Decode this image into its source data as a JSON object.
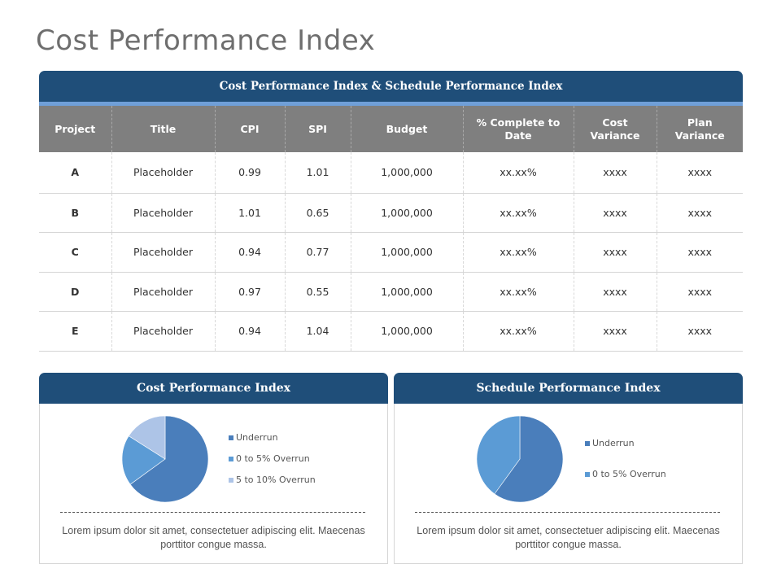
{
  "page": {
    "title": "Cost Performance Index"
  },
  "table": {
    "banner": "Cost Performance Index & Schedule Performance Index",
    "headers": [
      "Project",
      "Title",
      "CPI",
      "SPI",
      "Budget",
      "% Complete to Date",
      "Cost Variance",
      "Plan Variance"
    ],
    "rows": [
      [
        "A",
        "Placeholder",
        "0.99",
        "1.01",
        "1,000,000",
        "xx.xx%",
        "xxxx",
        "xxxx"
      ],
      [
        "B",
        "Placeholder",
        "1.01",
        "0.65",
        "1,000,000",
        "xx.xx%",
        "xxxx",
        "xxxx"
      ],
      [
        "C",
        "Placeholder",
        "0.94",
        "0.77",
        "1,000,000",
        "xx.xx%",
        "xxxx",
        "xxxx"
      ],
      [
        "D",
        "Placeholder",
        "0.97",
        "0.55",
        "1,000,000",
        "xx.xx%",
        "xxxx",
        "xxxx"
      ],
      [
        "E",
        "Placeholder",
        "0.94",
        "1.04",
        "1,000,000",
        "xx.xx%",
        "xxxx",
        "xxxx"
      ]
    ]
  },
  "colors": {
    "header_blue": "#1f4e79",
    "accent_blue": "#6f9fd8",
    "table_header_gray": "#7f7f7f",
    "underrun": "#4a7ebb",
    "overrun_0_5": "#5b9bd5",
    "overrun_5_10": "#adc4e7"
  },
  "chart_data": [
    {
      "type": "pie",
      "title": "Cost Performance Index",
      "categories": [
        "Underrun",
        "0 to 5% Overrun",
        "5 to 10% Overrun"
      ],
      "values": [
        65,
        19,
        16
      ],
      "colors": [
        "#4a7ebb",
        "#5b9bd5",
        "#adc4e7"
      ],
      "legend": "right",
      "description": "Lorem ipsum dolor sit amet, consectetuer adipiscing elit. Maecenas porttitor congue massa."
    },
    {
      "type": "pie",
      "title": "Schedule Performance Index",
      "categories": [
        "Underrun",
        "0 to 5% Overrun"
      ],
      "values": [
        60,
        40
      ],
      "colors": [
        "#4a7ebb",
        "#5b9bd5"
      ],
      "legend": "right",
      "description": "Lorem ipsum dolor sit amet, consectetuer adipiscing elit. Maecenas porttitor congue massa."
    }
  ]
}
